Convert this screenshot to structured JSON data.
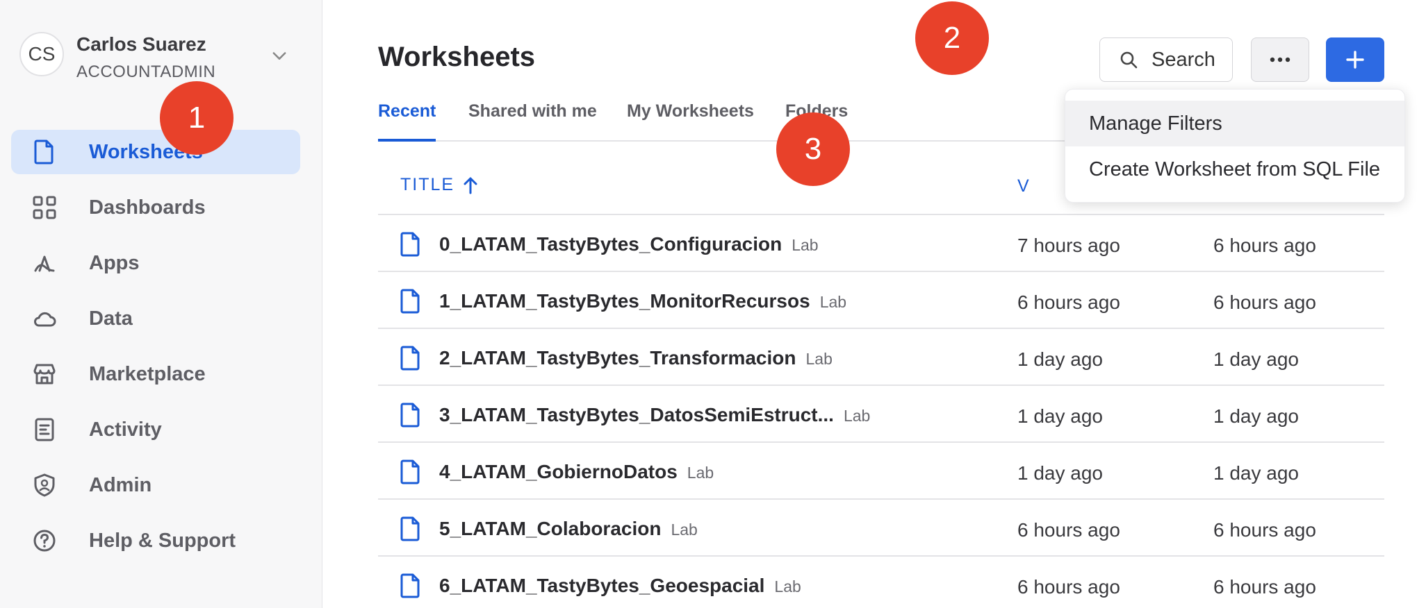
{
  "user": {
    "initials": "CS",
    "name": "Carlos Suarez",
    "role": "ACCOUNTADMIN"
  },
  "nav": {
    "items": [
      {
        "label": "Worksheets",
        "icon": "document-icon",
        "active": true
      },
      {
        "label": "Dashboards",
        "icon": "grid-icon"
      },
      {
        "label": "Apps",
        "icon": "apps-icon"
      },
      {
        "label": "Data",
        "icon": "cloud-icon"
      },
      {
        "label": "Marketplace",
        "icon": "store-icon"
      },
      {
        "label": "Activity",
        "icon": "activity-icon"
      },
      {
        "label": "Admin",
        "icon": "shield-icon"
      },
      {
        "label": "Help & Support",
        "icon": "help-icon"
      }
    ]
  },
  "header": {
    "title": "Worksheets",
    "search_label": "Search"
  },
  "tabs": [
    {
      "label": "Recent",
      "active": true
    },
    {
      "label": "Shared with me"
    },
    {
      "label": "My Worksheets"
    },
    {
      "label": "Folders"
    }
  ],
  "table": {
    "title_header": "TITLE",
    "viewed_header": "V",
    "rows": [
      {
        "name": "0_LATAM_TastyBytes_Configuracion",
        "tag": "Lab",
        "viewed": "7 hours ago",
        "updated": "6 hours ago"
      },
      {
        "name": "1_LATAM_TastyBytes_MonitorRecursos",
        "tag": "Lab",
        "viewed": "6 hours ago",
        "updated": "6 hours ago"
      },
      {
        "name": "2_LATAM_TastyBytes_Transformacion",
        "tag": "Lab",
        "viewed": "1 day ago",
        "updated": "1 day ago"
      },
      {
        "name": "3_LATAM_TastyBytes_DatosSemiEstruct...",
        "tag": "Lab",
        "viewed": "1 day ago",
        "updated": "1 day ago"
      },
      {
        "name": "4_LATAM_GobiernoDatos",
        "tag": "Lab",
        "viewed": "1 day ago",
        "updated": "1 day ago"
      },
      {
        "name": "5_LATAM_Colaboracion",
        "tag": "Lab",
        "viewed": "6 hours ago",
        "updated": "6 hours ago"
      },
      {
        "name": "6_LATAM_TastyBytes_Geoespacial",
        "tag": "Lab",
        "viewed": "6 hours ago",
        "updated": "6 hours ago"
      }
    ]
  },
  "menu": {
    "items": [
      "Manage Filters",
      "Create Worksheet from SQL File"
    ]
  },
  "badges": [
    "1",
    "2",
    "3"
  ],
  "colors": {
    "accent": "#2d6ae3",
    "active_text": "#1a5bd6",
    "active_bg": "#d9e6fb",
    "badge": "#e8412a"
  }
}
